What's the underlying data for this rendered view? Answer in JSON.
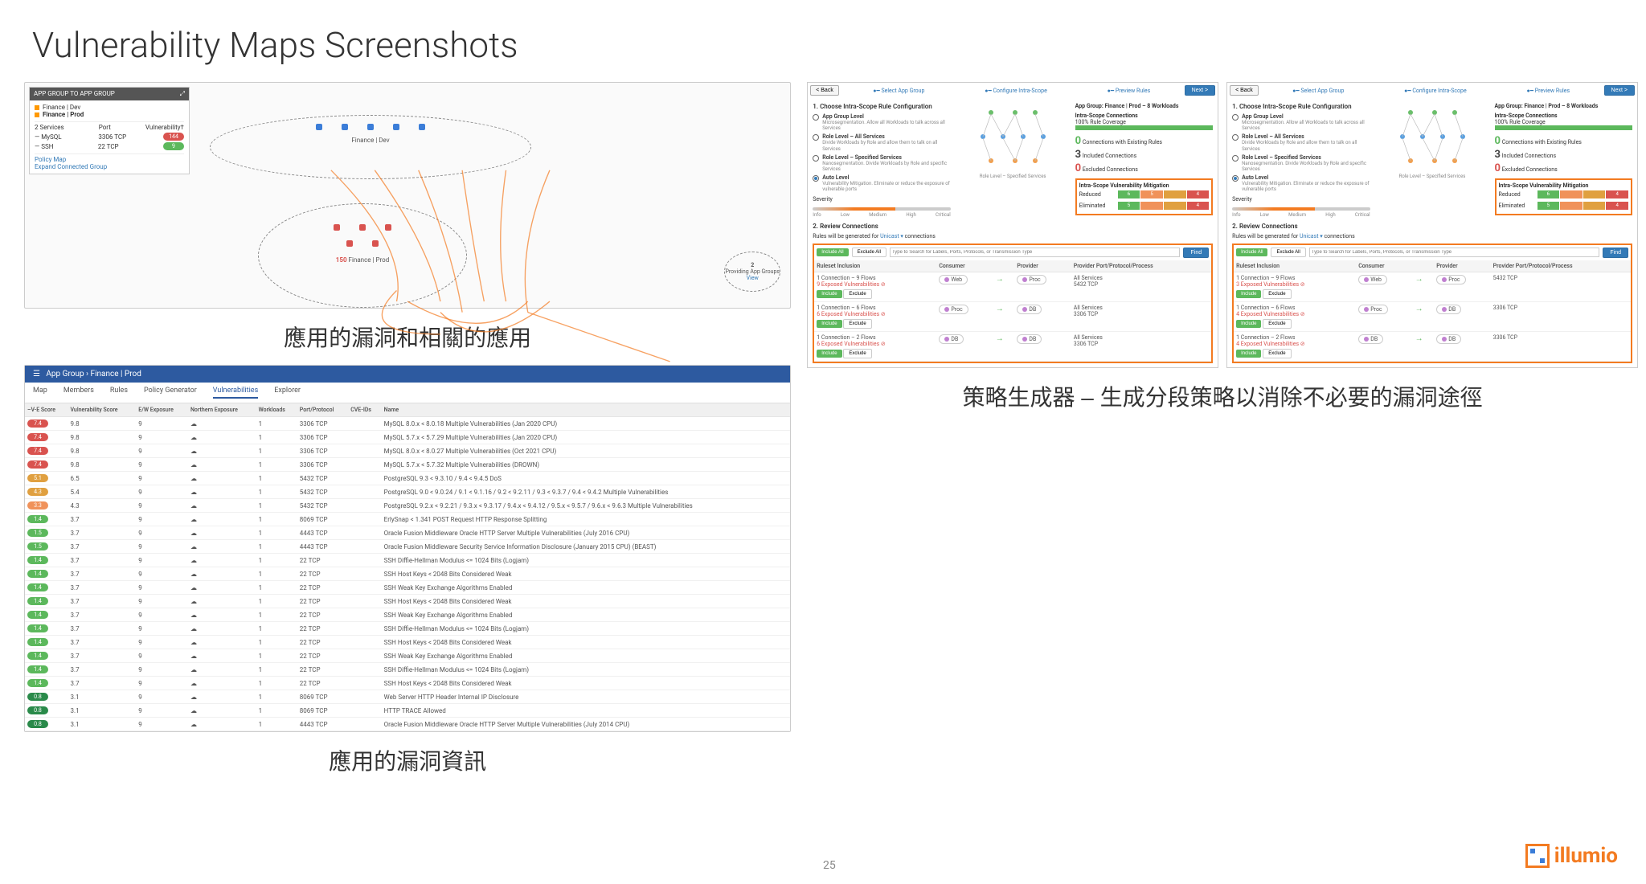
{
  "title": "Vulnerability Maps Screenshots",
  "page_number": "25",
  "logo_text": "illumio",
  "captions": {
    "map": "應用的漏洞和相關的應用",
    "policy": "策略生成器 – 生成分段策略以消除不必要的漏洞途徑",
    "table": "應用的漏洞資訊"
  },
  "legend": {
    "header": "APP GROUP TO APP GROUP",
    "env1": "Finance | Dev",
    "env2": "Finance | Prod",
    "cols": [
      "2 Services",
      "Port",
      "Vulnerability†"
    ],
    "rows": [
      {
        "svc": "MySQL",
        "port": "3306 TCP",
        "cls": "bg-red",
        "val": "144"
      },
      {
        "svc": "SSH",
        "port": "22 TCP",
        "cls": "bg-green",
        "val": "9"
      }
    ],
    "links": [
      "Policy Map",
      "Expand Connected Group"
    ]
  },
  "map": {
    "label_dev": "Finance | Dev",
    "label_prod_count": "150",
    "label_prod": "Finance | Prod",
    "providing_num": "2",
    "providing_txt": "Providing App Groups",
    "providing_view": "View"
  },
  "vuln_header": {
    "bar": "App Group  ›  Finance | Prod",
    "tabs": [
      "Map",
      "Members",
      "Rules",
      "Policy Generator",
      "Vulnerabilities",
      "Explorer"
    ],
    "active": 4,
    "cols": [
      "–V-E Score",
      "Vulnerability Score",
      "E/W Exposure",
      "Northern Exposure",
      "Workloads",
      "Port/Protocol",
      "CVE-IDs",
      "Name"
    ]
  },
  "vuln_rows": [
    {
      "b": "bg-red",
      "ve": "7.4",
      "vs": "9.8",
      "ew": "9",
      "wl": "1",
      "port": "3306 TCP",
      "name": "MySQL 8.0.x < 8.0.18 Multiple Vulnerabilities (Jan 2020 CPU)"
    },
    {
      "b": "bg-red",
      "ve": "7.4",
      "vs": "9.8",
      "ew": "9",
      "wl": "1",
      "port": "3306 TCP",
      "name": "MySQL 5.7.x < 5.7.29 Multiple Vulnerabilities (Jan 2020 CPU)"
    },
    {
      "b": "bg-red",
      "ve": "7.4",
      "vs": "9.8",
      "ew": "9",
      "wl": "1",
      "port": "3306 TCP",
      "name": "MySQL 8.0.x < 8.0.27 Multiple Vulnerabilities (Oct 2021 CPU)"
    },
    {
      "b": "bg-red",
      "ve": "7.4",
      "vs": "9.8",
      "ew": "9",
      "wl": "1",
      "port": "3306 TCP",
      "name": "MySQL 5.7.x < 5.7.32 Multiple Vulnerabilities (DROWN)"
    },
    {
      "b": "bg-yellow",
      "ve": "5.1",
      "vs": "6.5",
      "ew": "9",
      "wl": "1",
      "port": "5432 TCP",
      "name": "PostgreSQL 9.3 < 9.3.10 / 9.4 < 9.4.5 DoS"
    },
    {
      "b": "bg-yellow",
      "ve": "4.3",
      "vs": "5.4",
      "ew": "9",
      "wl": "1",
      "port": "5432 TCP",
      "name": "PostgreSQL 9.0 < 9.0.24 / 9.1 < 9.1.16 / 9.2 < 9.2.11 / 9.3 < 9.3.7 / 9.4 < 9.4.2 Multiple Vulnerabilities"
    },
    {
      "b": "bg-orange",
      "ve": "3.3",
      "vs": "4.3",
      "ew": "9",
      "wl": "1",
      "port": "5432 TCP",
      "name": "PostgreSQL 9.2.x < 9.2.21 / 9.3.x < 9.3.17 / 9.4.x < 9.4.12 / 9.5.x < 9.5.7 / 9.6.x < 9.6.3 Multiple Vulnerabilities"
    },
    {
      "b": "bg-green",
      "ve": "1.4",
      "vs": "3.7",
      "ew": "9",
      "wl": "1",
      "port": "8069 TCP",
      "name": "ErlySnap < 1.341 POST Request HTTP Response Splitting"
    },
    {
      "b": "bg-green",
      "ve": "1.5",
      "vs": "3.7",
      "ew": "9",
      "wl": "1",
      "port": "4443 TCP",
      "name": "Oracle Fusion Middleware Oracle HTTP Server Multiple Vulnerabilities (July 2016 CPU)"
    },
    {
      "b": "bg-green",
      "ve": "1.5",
      "vs": "3.7",
      "ew": "9",
      "wl": "1",
      "port": "4443 TCP",
      "name": "Oracle Fusion Middleware Security Service Information Disclosure (January 2015 CPU) (BEAST)"
    },
    {
      "b": "bg-green",
      "ve": "1.4",
      "vs": "3.7",
      "ew": "9",
      "wl": "1",
      "port": "22 TCP",
      "name": "SSH Diffie-Hellman Modulus <= 1024 Bits (Logjam)"
    },
    {
      "b": "bg-green",
      "ve": "1.4",
      "vs": "3.7",
      "ew": "9",
      "wl": "1",
      "port": "22 TCP",
      "name": "SSH Host Keys < 2048 Bits Considered Weak"
    },
    {
      "b": "bg-green",
      "ve": "1.4",
      "vs": "3.7",
      "ew": "9",
      "wl": "1",
      "port": "22 TCP",
      "name": "SSH Weak Key Exchange Algorithms Enabled"
    },
    {
      "b": "bg-green",
      "ve": "1.4",
      "vs": "3.7",
      "ew": "9",
      "wl": "1",
      "port": "22 TCP",
      "name": "SSH Host Keys < 2048 Bits Considered Weak"
    },
    {
      "b": "bg-green",
      "ve": "1.4",
      "vs": "3.7",
      "ew": "9",
      "wl": "1",
      "port": "22 TCP",
      "name": "SSH Weak Key Exchange Algorithms Enabled"
    },
    {
      "b": "bg-green",
      "ve": "1.4",
      "vs": "3.7",
      "ew": "9",
      "wl": "1",
      "port": "22 TCP",
      "name": "SSH Diffie-Hellman Modulus <= 1024 Bits (Logjam)"
    },
    {
      "b": "bg-green",
      "ve": "1.4",
      "vs": "3.7",
      "ew": "9",
      "wl": "1",
      "port": "22 TCP",
      "name": "SSH Host Keys < 2048 Bits Considered Weak"
    },
    {
      "b": "bg-green",
      "ve": "1.4",
      "vs": "3.7",
      "ew": "9",
      "wl": "1",
      "port": "22 TCP",
      "name": "SSH Weak Key Exchange Algorithms Enabled"
    },
    {
      "b": "bg-green",
      "ve": "1.4",
      "vs": "3.7",
      "ew": "9",
      "wl": "1",
      "port": "22 TCP",
      "name": "SSH Diffie-Hellman Modulus <= 1024 Bits (Logjam)"
    },
    {
      "b": "bg-green",
      "ve": "1.4",
      "vs": "3.7",
      "ew": "9",
      "wl": "1",
      "port": "22 TCP",
      "name": "SSH Host Keys < 2048 Bits Considered Weak"
    },
    {
      "b": "bg-darkgreen",
      "ve": "0.8",
      "vs": "3.1",
      "ew": "9",
      "wl": "1",
      "port": "8069 TCP",
      "name": "Web Server HTTP Header Internal IP Disclosure"
    },
    {
      "b": "bg-darkgreen",
      "ve": "0.8",
      "vs": "3.1",
      "ew": "9",
      "wl": "1",
      "port": "8069 TCP",
      "name": "HTTP TRACE Allowed"
    },
    {
      "b": "bg-darkgreen",
      "ve": "0.8",
      "vs": "3.1",
      "ew": "9",
      "wl": "1",
      "port": "4443 TCP",
      "name": "Oracle Fusion Middleware Oracle HTTP Server Multiple Vulnerabilities (July 2014 CPU)"
    }
  ],
  "wizard": {
    "back": "< Back",
    "next": "Next >",
    "steps": [
      "Select App Group",
      "Configure Intra-Scope",
      "Preview Rules"
    ],
    "s1_title": "1. Choose Intra-Scope Rule Configuration",
    "opts": [
      {
        "t": "App Group Level",
        "d": "Microsegmentation. Allow all Workloads to talk across all Services"
      },
      {
        "t": "Role Level – All Services",
        "d": "Divide Workloads by Role and allow them to talk on all Services"
      },
      {
        "t": "Role Level – Specified Services",
        "d": "Nanosegmentation. Divide Workloads by Role and specific Services"
      },
      {
        "t": "Auto Level",
        "d": "Vulnerability Mitigation. Eliminate or reduce the exposure of vulnerable ports"
      }
    ],
    "sev_label": "Severity",
    "sev_ticks": [
      "Info",
      "Low",
      "Medium",
      "High",
      "Critical"
    ],
    "diagram_caption": "Role Level – Specified Services",
    "diagram_caption2": "Role Level – Specified Services",
    "app_group": "App Group: Finance | Prod – 8 Workloads",
    "cov_label": "Intra-Scope Connections",
    "cov_val": "100% Rule Coverage",
    "stats": [
      {
        "n": "0",
        "l": "Connections with Existing Rules",
        "c": "#5cb85c"
      },
      {
        "n": "3",
        "l": "Included Connections",
        "c": "#444"
      },
      {
        "n": "0",
        "l": "Excluded Connections",
        "c": "#d9534f"
      }
    ],
    "mitig_title": "Intra-Scope Vulnerability Mitigation",
    "mitig_rows": [
      "Reduced",
      "Eliminated"
    ],
    "mitig_a": [
      [
        "6",
        "5",
        "",
        "4"
      ],
      [
        "5",
        "",
        "",
        "4"
      ]
    ],
    "mitig_b": [
      [
        "6",
        "",
        "",
        "4"
      ],
      [
        "5",
        "",
        "",
        "4"
      ]
    ],
    "s2_title": "2. Review Connections",
    "s2_sub_pre": "Rules will be generated for ",
    "s2_sub_link": "Unicast",
    "s2_sub_post": " connections",
    "inc_all": "Include All",
    "exc_all": "Exclude All",
    "search_ph": "Type to Search for Labels, Ports, Protocols, or Transmission Type",
    "find": "Find",
    "cols": [
      "Ruleset Inclusion",
      "Consumer",
      "",
      "Provider",
      "Provider Port/Protocol/Process"
    ],
    "include": "Include",
    "exclude": "Exclude",
    "rowsA": [
      {
        "t": "1 Connection – 9 Flows",
        "e": "9 Exposed Vulnerabilities",
        "c": "Web",
        "p": "Proc",
        "s": "All Services",
        "s2": "5432 TCP"
      },
      {
        "t": "1 Connection – 6 Flows",
        "e": "6 Exposed Vulnerabilities",
        "c": "Proc",
        "p": "DB",
        "s": "All Services",
        "s2": "3306 TCP"
      },
      {
        "t": "1 Connection – 2 Flows",
        "e": "6 Exposed Vulnerabilities",
        "c": "DB",
        "p": "DB",
        "s": "All Services",
        "s2": "3306 TCP"
      }
    ],
    "rowsB": [
      {
        "t": "1 Connection – 9 Flows",
        "e": "3 Exposed Vulnerabilities",
        "c": "Web",
        "p": "Proc",
        "s": "5432 TCP"
      },
      {
        "t": "1 Connection – 6 Flows",
        "e": "4 Exposed Vulnerabilities",
        "c": "Proc",
        "p": "DB",
        "s": "3306 TCP"
      },
      {
        "t": "1 Connection – 2 Flows",
        "e": "4 Exposed Vulnerabilities",
        "c": "DB",
        "p": "DB",
        "s": "3306 TCP"
      }
    ]
  }
}
